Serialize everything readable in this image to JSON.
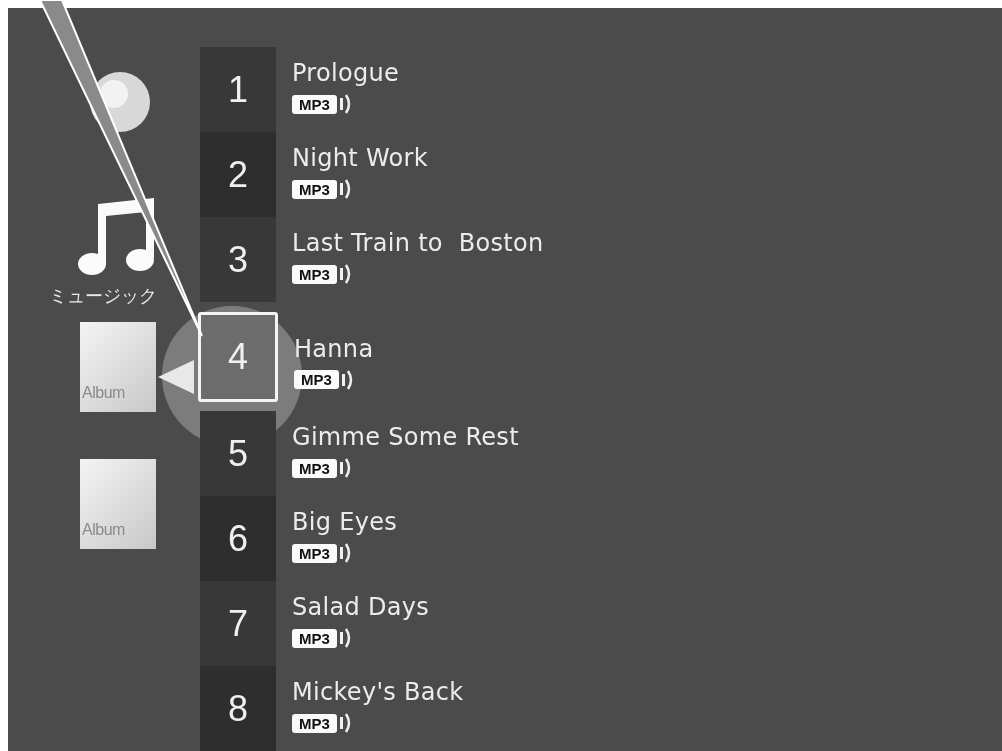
{
  "category": {
    "label": "ミュージック"
  },
  "albums": [
    {
      "label": "Album"
    },
    {
      "label": "Album"
    }
  ],
  "tracks": [
    {
      "number": "1",
      "title": "Prologue",
      "format": "MP3",
      "selected": false
    },
    {
      "number": "2",
      "title": "Night Work",
      "format": "MP3",
      "selected": false
    },
    {
      "number": "3",
      "title": "Last Train to  Boston",
      "format": "MP3",
      "selected": false
    },
    {
      "number": "4",
      "title": "Hanna",
      "format": "MP3",
      "selected": true
    },
    {
      "number": "5",
      "title": "Gimme Some Rest",
      "format": "MP3",
      "selected": false
    },
    {
      "number": "6",
      "title": "Big Eyes",
      "format": "MP3",
      "selected": false
    },
    {
      "number": "7",
      "title": "Salad Days",
      "format": "MP3",
      "selected": false
    },
    {
      "number": "8",
      "title": "Mickey's Back",
      "format": "MP3",
      "selected": false
    }
  ]
}
